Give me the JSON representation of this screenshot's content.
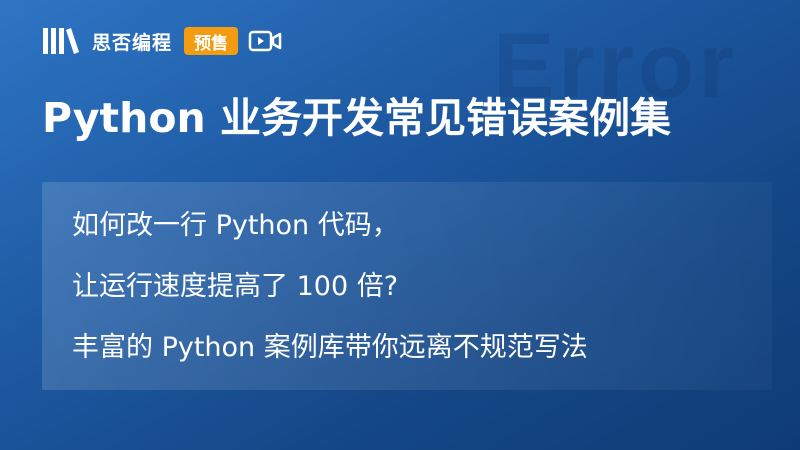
{
  "brand": {
    "name": "思否编程",
    "badge": "预售",
    "logo_icon": "books-icon",
    "media_icon": "video-camera-icon"
  },
  "watermark": "Error",
  "title": "Python 业务开发常见错误案例集",
  "panel": {
    "lines": [
      "如何改一行 Python 代码，",
      "让运行速度提高了 100 倍?",
      "丰富的 Python 案例库带你远离不规范写法"
    ]
  },
  "colors": {
    "background_start": "#2e75c4",
    "background_end": "#0f3c75",
    "badge": "#f39c12",
    "text": "#ffffff"
  }
}
